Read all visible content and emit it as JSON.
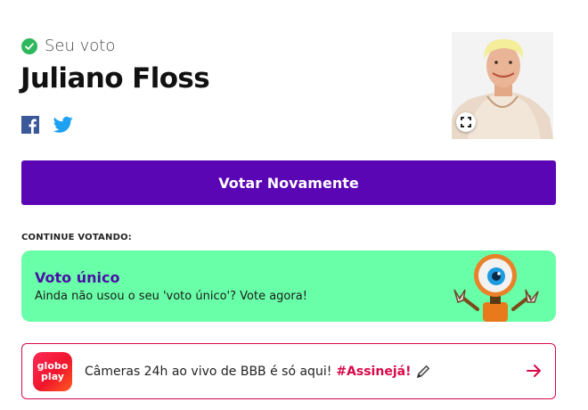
{
  "status": {
    "icon": "check-circle-icon",
    "label": "Seu voto"
  },
  "candidate": {
    "name": "Juliano Floss"
  },
  "share": {
    "facebook_icon": "facebook-icon",
    "twitter_icon": "twitter-icon"
  },
  "photo": {
    "expand_icon": "expand-icon"
  },
  "actions": {
    "vote_again_label": "Votar Novamente"
  },
  "continue_section": {
    "label": "CONTINUE VOTANDO:",
    "single_vote": {
      "title": "Voto único",
      "description": "Ainda não usou o seu 'voto único'? Vote agora!"
    }
  },
  "promo": {
    "logo_line1": "globo",
    "logo_line2": "play",
    "text": "Câmeras 24h ao vivo de BBB é só aqui!",
    "cta": "#Assinejá!",
    "arrow_icon": "arrow-right-icon"
  },
  "colors": {
    "primary": "#5a06b4",
    "card_green": "#69ffa8",
    "accent_red": "#d80a48",
    "check_green": "#2fb75d"
  }
}
